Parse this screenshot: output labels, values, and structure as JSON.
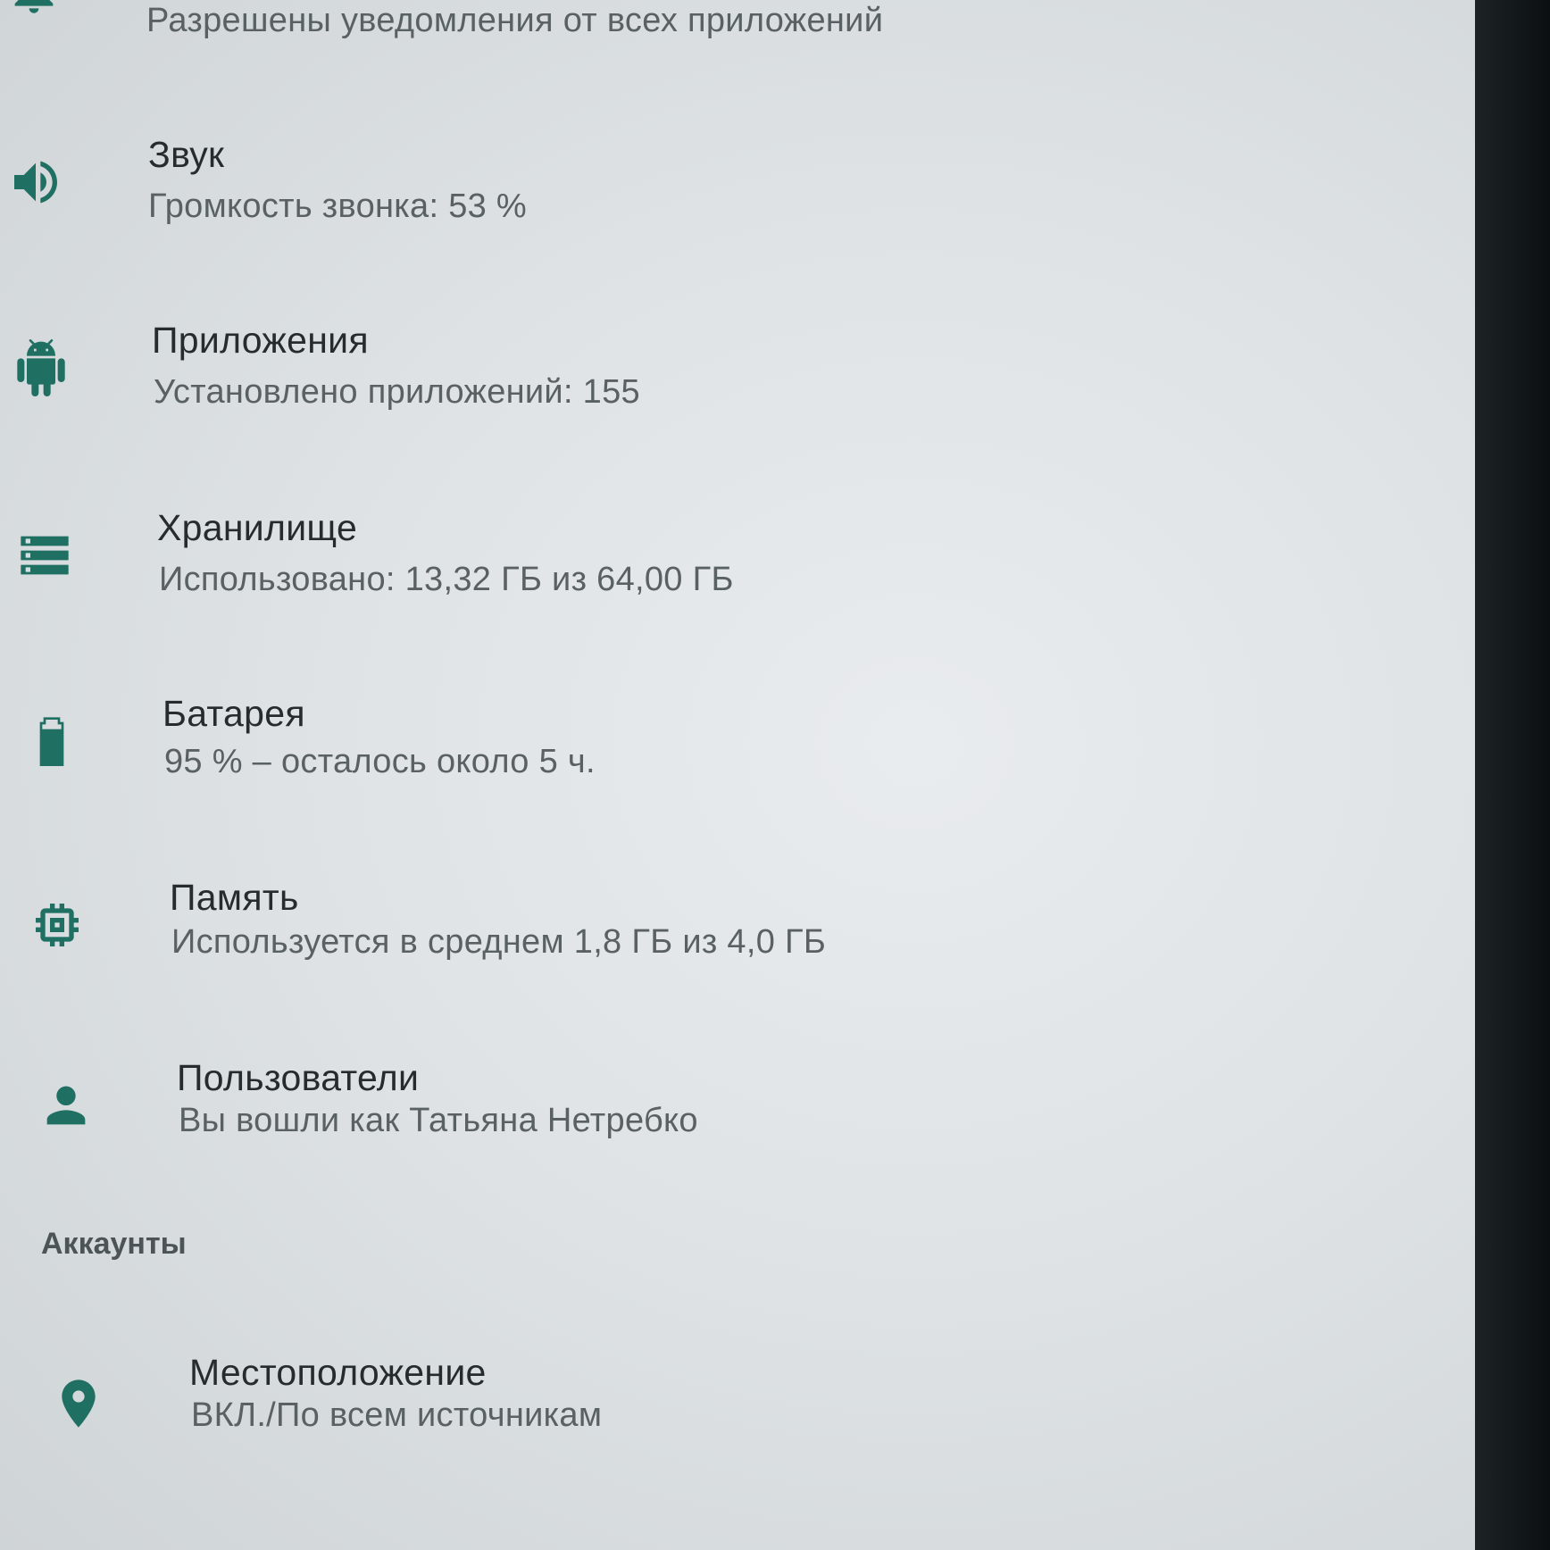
{
  "colors": {
    "accent": "#1f6f62",
    "title_text": "#262b2d",
    "summary_text": "#5a6164",
    "background": "#e4e7e9"
  },
  "top_partial": {
    "icon": "bell-icon",
    "summary": "Разрешены уведомления от всех приложений"
  },
  "items": [
    {
      "icon": "volume-icon",
      "title": "Звук",
      "summary": "Громкость звонка: 53 %"
    },
    {
      "icon": "android-icon",
      "title": "Приложения",
      "summary": "Установлено приложений: 155"
    },
    {
      "icon": "storage-icon",
      "title": "Хранилище",
      "summary": "Использовано: 13,32 ГБ из 64,00 ГБ"
    },
    {
      "icon": "battery-icon",
      "title": "Батарея",
      "summary": "95 % – осталось около 5 ч."
    },
    {
      "icon": "memory-icon",
      "title": "Память",
      "summary": "Используется в среднем 1,8 ГБ из 4,0 ГБ"
    },
    {
      "icon": "person-icon",
      "title": "Пользователи",
      "summary": "Вы вошли как Татьяна Нетребко"
    }
  ],
  "section_header": "Аккаунты",
  "location": {
    "icon": "location-pin-icon",
    "title": "Местоположение",
    "summary": "ВКЛ./По всем источникам"
  }
}
